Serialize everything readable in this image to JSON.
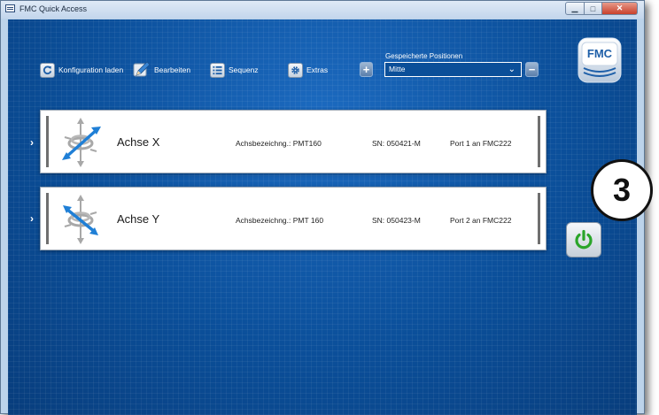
{
  "window": {
    "title": "FMC Quick Access"
  },
  "toolbar": {
    "config_label": "Konfiguration laden",
    "edit_label": "Bearbeiten",
    "sequence_label": "Sequenz",
    "extras_label": "Extras"
  },
  "positions": {
    "label": "Gespeicherte Positionen",
    "selected": "Mitte",
    "add": "+",
    "remove": "−"
  },
  "logo": {
    "text": "FMC"
  },
  "axes": [
    {
      "name": "Achse X",
      "designation": "Achsbezeichng.: PMT160",
      "sn": "SN: 050421-M",
      "port": "Port 1 an FMC222"
    },
    {
      "name": "Achse Y",
      "designation": "Achsbezeichng.: PMT 160",
      "sn": "SN: 050423-M",
      "port": "Port 2 an FMC222"
    }
  ],
  "step_badge": "3",
  "colors": {
    "background": "#0a4c95",
    "power_green": "#2aa52a",
    "axis_blue": "#1f7fd6"
  }
}
